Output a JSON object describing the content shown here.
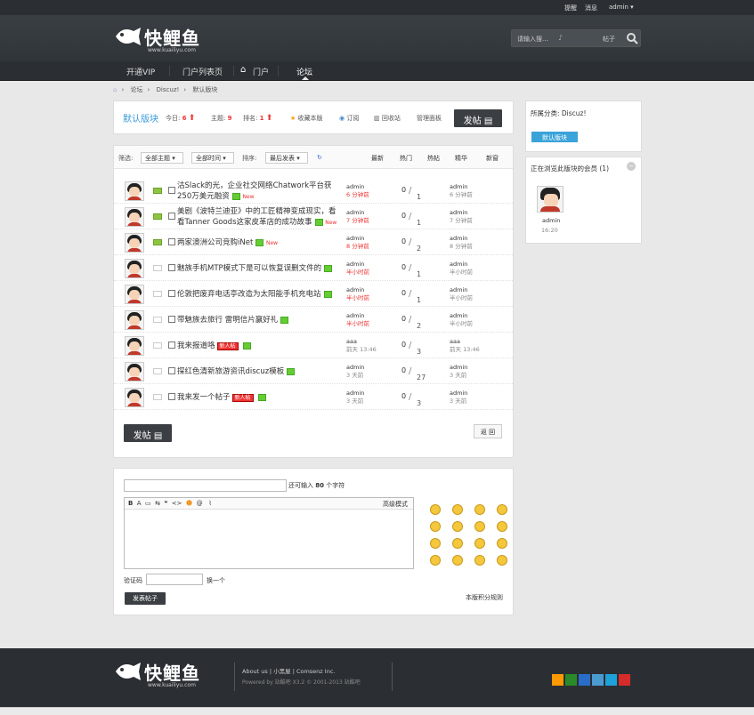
{
  "topbar": {
    "remind": "提醒",
    "messages": "消息",
    "user": "admin"
  },
  "header": {
    "logo_text": "快鲤鱼",
    "logo_url": "www.kuailiyu.com",
    "search_placeholder": "请输入搜…",
    "search_type": "帖子"
  },
  "nav": {
    "items": [
      "开通VIP",
      "门户列表页",
      "门户",
      "论坛"
    ]
  },
  "breadcrumb": [
    "论坛",
    "Discuz!",
    "默认版块"
  ],
  "forum": {
    "name": "默认版块",
    "today_label": "今日:",
    "today": "6",
    "topics_label": "主题:",
    "topics": "9",
    "rank_label": "排名:",
    "rank": "1",
    "fav": "收藏本版",
    "subscribe": "订阅",
    "recycle": "回收站",
    "manage": "管理面板",
    "post_btn": "发帖"
  },
  "filter": {
    "label": "筛选:",
    "all_topics": "全部主题",
    "all_time": "全部时间",
    "sort_label": "排序:",
    "sort": "最后发表",
    "tabs": [
      "最新",
      "热门",
      "热帖",
      "精华",
      "新窗"
    ]
  },
  "threads": [
    {
      "title": "沽Slack的光，企业社交网络Chatwork平台获250万美元融资",
      "extra": "New",
      "author": "admin",
      "atime": "6 分钟前",
      "replies": "0",
      "views": "1",
      "last": "admin",
      "ltime": "6 分钟前",
      "hot": true
    },
    {
      "title": "美剧《波特兰迪亚》中的工匠精神变成现实，看看Tanner Goods这家皮革店的成功故事",
      "extra": "New",
      "author": "admin",
      "atime": "7 分钟前",
      "replies": "0",
      "views": "1",
      "last": "admin",
      "ltime": "7 分钟前",
      "hot": true
    },
    {
      "title": "两家澳洲公司竞购iNet",
      "extra": "New",
      "author": "admin",
      "atime": "8 分钟前",
      "replies": "0",
      "views": "2",
      "last": "admin",
      "ltime": "8 分钟前",
      "hot": true
    },
    {
      "title": "魅族手机MTP模式下是可以恢复误删文件的",
      "extra": "",
      "author": "admin",
      "atime": "半小时前",
      "replies": "0",
      "views": "1",
      "last": "admin",
      "ltime": "半小时前",
      "hot": false
    },
    {
      "title": "伦敦把废弃电话亭改造为太阳能手机充电站",
      "extra": "",
      "author": "admin",
      "atime": "半小时前",
      "replies": "0",
      "views": "1",
      "last": "admin",
      "ltime": "半小时前",
      "hot": false
    },
    {
      "title": "带魅族去旅行 雷明信片赢好礼",
      "extra": "",
      "author": "admin",
      "atime": "半小时前",
      "replies": "0",
      "views": "2",
      "last": "admin",
      "ltime": "半小时前",
      "hot": false
    },
    {
      "title": "我来报道咯",
      "extra": "新人帖",
      "author": "aaa",
      "atime": "前天 13:46",
      "replies": "0",
      "views": "3",
      "last": "aaa",
      "ltime": "前天 13:46",
      "hot": false
    },
    {
      "title": "探红色清新旅游资讯discuz模板",
      "extra": "",
      "author": "admin",
      "atime": "3 天前",
      "replies": "0",
      "views": "27",
      "last": "admin",
      "ltime": "3 天前",
      "hot": false
    },
    {
      "title": "我来发一个帖子",
      "extra": "新人帖",
      "author": "admin",
      "atime": "3 天前",
      "replies": "0",
      "views": "3",
      "last": "admin",
      "ltime": "3 天前",
      "hot": false
    }
  ],
  "list_footer": {
    "post_btn": "发帖",
    "back": "返 回"
  },
  "sidebar": {
    "category": "所属分类: Discuz!",
    "forum_btn": "默认版块",
    "browsing": "正在浏览此版块的会员 (1)",
    "member": "admin",
    "member_time": "16:20"
  },
  "editor": {
    "remain_label": "还可输入",
    "remain": "80",
    "unit": "个字符",
    "advanced": "高级模式",
    "captcha_label": "验证码",
    "captcha_change": "换一个",
    "submit": "发表帖子",
    "rules": "本版积分规则"
  },
  "footer": {
    "links": [
      "About us",
      "小黑屋",
      "Comsenz Inc."
    ],
    "powered": "Powered by 站酷吧 X3.2 © 2001-2013 站酷吧"
  }
}
